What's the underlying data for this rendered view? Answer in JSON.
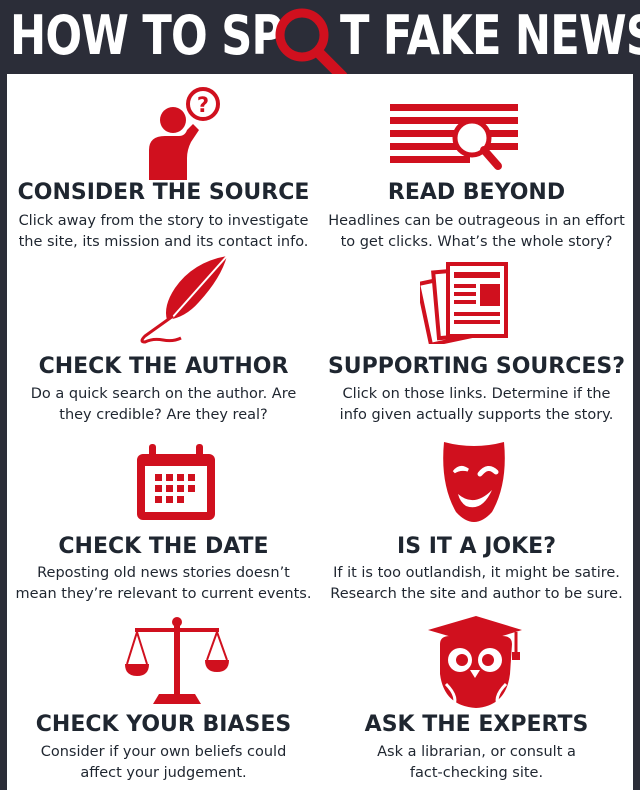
{
  "title": {
    "part1": "HOW TO SP",
    "part2": "T FAKE NEWS"
  },
  "colors": {
    "accent": "#d0101e",
    "dark": "#2b2d38",
    "text": "#1f2630"
  },
  "tips": [
    {
      "icon": "thinking-person-icon",
      "heading": "CONSIDER THE SOURCE",
      "line1": "Click away from the story to investigate",
      "line2": "the site, its mission and its contact info."
    },
    {
      "icon": "magnified-text-icon",
      "heading": "READ BEYOND",
      "line1": "Headlines can be outrageous in an effort",
      "line2": "to get clicks. What’s the whole story?"
    },
    {
      "icon": "quill-pen-icon",
      "heading": "CHECK THE AUTHOR",
      "line1": "Do a quick search on the author. Are",
      "line2": "they credible? Are they real?"
    },
    {
      "icon": "documents-icon",
      "heading": "SUPPORTING SOURCES?",
      "line1": "Click on those links. Determine if the",
      "line2": "info given actually supports the story."
    },
    {
      "icon": "calendar-icon",
      "heading": "CHECK THE DATE",
      "line1": "Reposting old news stories doesn’t",
      "line2": "mean they’re relevant to current events."
    },
    {
      "icon": "winking-mask-icon",
      "heading": "IS IT A JOKE?",
      "line1": "If it is too outlandish, it might be satire.",
      "line2": "Research the site and author to be sure."
    },
    {
      "icon": "balance-scale-icon",
      "heading": "CHECK YOUR BIASES",
      "line1": "Consider if your own beliefs could",
      "line2": "affect your judgement."
    },
    {
      "icon": "graduate-owl-icon",
      "heading": "ASK THE EXPERTS",
      "line1": "Ask a librarian, or consult a",
      "line2": "fact-checking site."
    }
  ]
}
